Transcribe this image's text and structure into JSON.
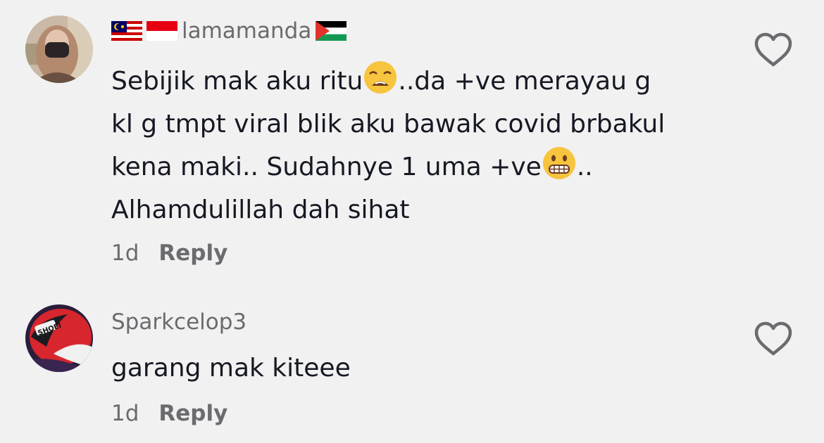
{
  "comments": [
    {
      "username": "lamamanda",
      "lines": [
        "Sebijik mak aku ritu",
        "..da +ve merayau g",
        "kl g tmpt viral blik aku bawak covid brbakul",
        "kena maki.. Sudahnye 1 uma +ve",
        "..",
        "Alhamdulillah dah sihat"
      ],
      "time": "1d",
      "reply": "Reply"
    },
    {
      "username": "Sparkcelop3",
      "lines": [
        "garang mak kiteee"
      ],
      "time": "1d",
      "reply": "Reply"
    }
  ],
  "icons": {
    "like": "heart-outline-icon",
    "flags": [
      "malaysia-flag-icon",
      "indonesia-flag-icon",
      "palestine-flag-icon"
    ],
    "emoji": [
      "weary-face-emoji",
      "grimacing-face-emoji"
    ]
  },
  "colors": {
    "background": "#f1f1f1",
    "text": "#161823",
    "secondary": "#6b6b6f"
  }
}
